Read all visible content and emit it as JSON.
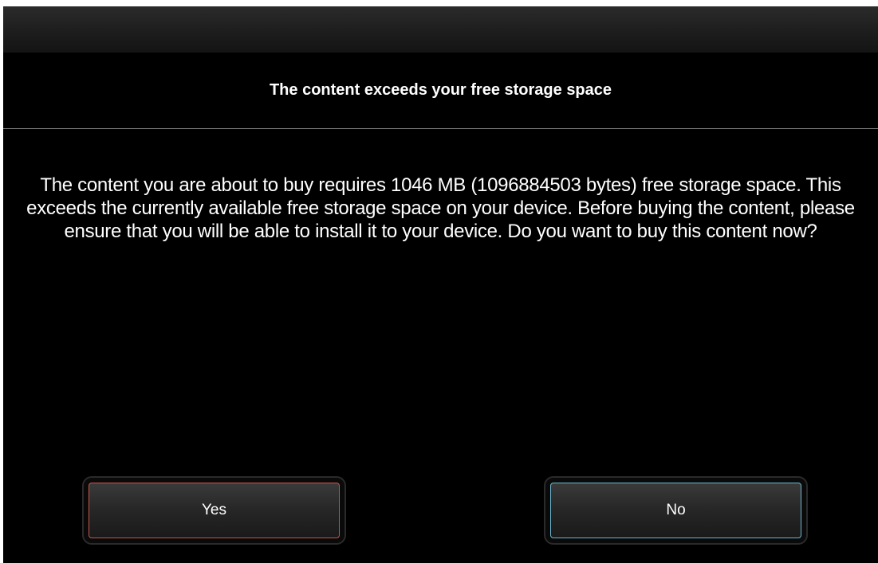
{
  "dialog": {
    "title": "The content exceeds your free storage space",
    "message": "The content you are about to buy requires 1046 MB (1096884503 bytes) free storage space. This exceeds the currently available free storage space on your device. Before buying the content, please ensure that you will be able to install it to your device. Do you want to buy this content now?",
    "buttons": {
      "yes_label": "Yes",
      "no_label": "No"
    }
  },
  "colors": {
    "background": "#000000",
    "text": "#ffffff",
    "yes_accent": "#c0584a",
    "no_accent": "#6fb6cf",
    "divider": "#7a7a7a"
  }
}
